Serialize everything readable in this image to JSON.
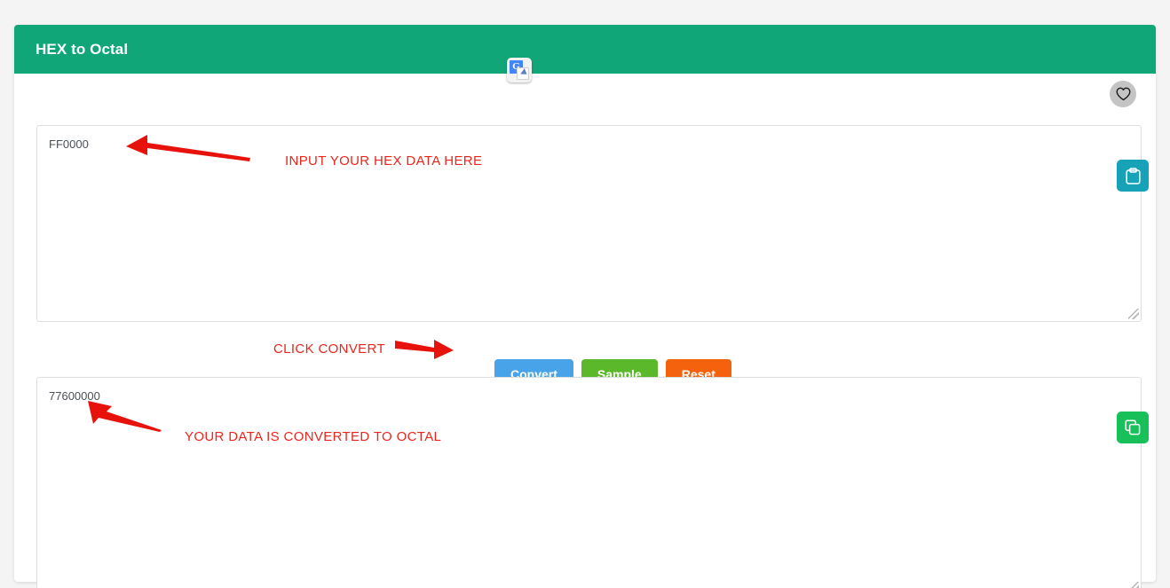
{
  "page": {
    "background_color": "#f4f4f4"
  },
  "card": {
    "header": {
      "title": "HEX to Octal",
      "background_color": "#10a678",
      "text_color": "#ffffff"
    }
  },
  "browser_extension": {
    "icon_name": "google-translate-icon",
    "glyph": "G"
  },
  "favorite": {
    "icon_name": "heart-icon",
    "background_color": "#c4c4c4"
  },
  "input_area": {
    "name": "hex-input-textarea",
    "value": "FF0000",
    "placeholder": "",
    "paste_button": {
      "icon_name": "clipboard-icon",
      "color": "#17a2b8"
    }
  },
  "output_area": {
    "name": "octal-output-textarea",
    "value": "77600000",
    "placeholder": "",
    "copy_button": {
      "icon_name": "copy-icon",
      "color": "#18c05a"
    }
  },
  "actions": {
    "convert_label": "Convert",
    "sample_label": "Sample",
    "reset_label": "Reset",
    "convert_color": "#49a3e8",
    "sample_color": "#5cb82b",
    "reset_color": "#f4620e"
  },
  "annotations": {
    "color": "#e8261c",
    "input_text": "INPUT YOUR HEX DATA HERE",
    "convert_text": "CLICK CONVERT",
    "output_text": "YOUR DATA IS CONVERTED TO OCTAL"
  }
}
